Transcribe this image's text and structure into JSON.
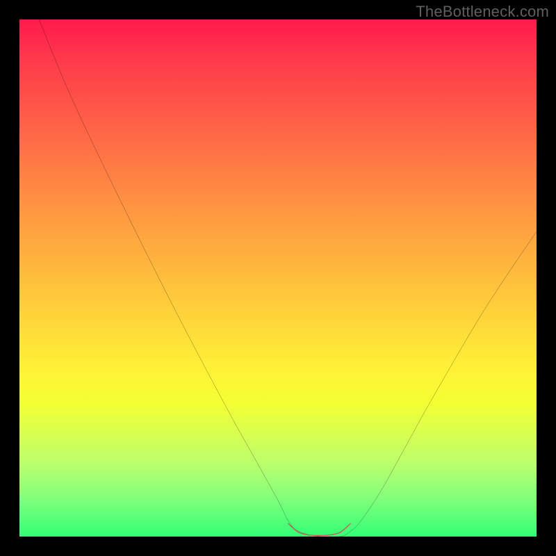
{
  "watermark": "TheBottleneck.com",
  "chart_data": {
    "type": "line",
    "title": "",
    "xlabel": "",
    "ylabel": "",
    "xlim": [
      0,
      100
    ],
    "ylim": [
      0,
      100
    ],
    "grid": false,
    "legend": false,
    "annotations": [],
    "series": [
      {
        "name": "bottleneck-curve",
        "color": "#000000",
        "x": [
          3.8,
          10,
          20,
          30,
          40,
          45,
          50,
          52,
          54,
          58,
          62,
          64,
          66,
          70,
          75,
          80,
          90,
          100
        ],
        "y": [
          100,
          85,
          64,
          44,
          25,
          16,
          7,
          3,
          1,
          0,
          0,
          1,
          3,
          9,
          18,
          27,
          44,
          59
        ]
      },
      {
        "name": "highlight-band",
        "color": "#d46a6a",
        "x": [
          52,
          54,
          56,
          58,
          60,
          62,
          64
        ],
        "y": [
          2.5,
          0.8,
          0.3,
          0.2,
          0.3,
          0.8,
          2.5
        ]
      }
    ],
    "gradient_background": {
      "direction": "top-to-bottom",
      "stops": [
        {
          "pos": 0,
          "color": "#ff1a4d"
        },
        {
          "pos": 0.5,
          "color": "#ffb83d"
        },
        {
          "pos": 0.75,
          "color": "#fff236"
        },
        {
          "pos": 1,
          "color": "#33ff77"
        }
      ]
    }
  }
}
